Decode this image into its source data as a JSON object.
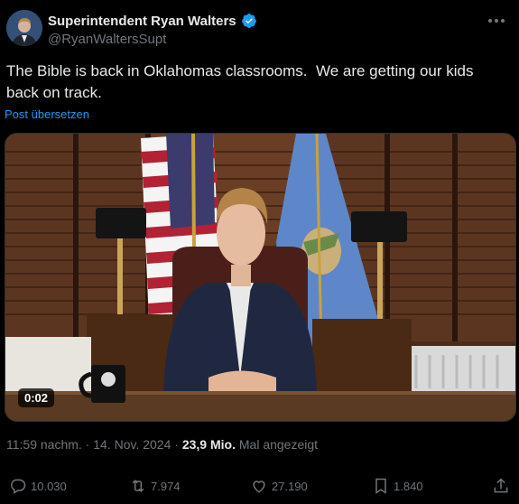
{
  "author": {
    "display_name": "Superintendent Ryan Walters",
    "handle": "@RyanWaltersSupt"
  },
  "tweet": {
    "text": "The Bible is back in Oklahomas classrooms.  We are getting our kids back on track.",
    "translate_label": "Post übersetzen"
  },
  "video": {
    "timestamp": "0:02"
  },
  "meta": {
    "time": "11:59 nachm.",
    "separator1": " · ",
    "date": "14. Nov. 2024",
    "separator2": " · ",
    "views_count": "23,9 Mio.",
    "views_label": " Mal angezeigt"
  },
  "actions": {
    "replies": "10.030",
    "reposts": "7.974",
    "likes": "27.190",
    "bookmarks": "1.840"
  },
  "colors": {
    "background": "#000000",
    "text": "#e7e9ea",
    "secondary_text": "#71767b",
    "accent": "#1d9bf0"
  }
}
